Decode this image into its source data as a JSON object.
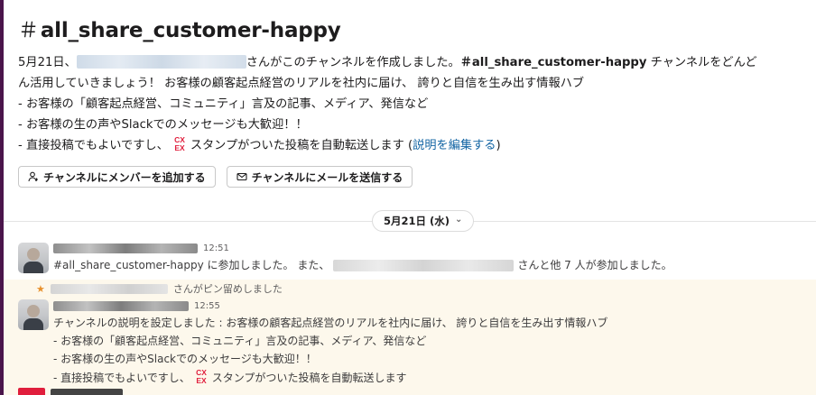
{
  "channel": {
    "hash": "＃",
    "name": "all_share_customer-happy"
  },
  "intro": {
    "date_prefix": "5月21日、",
    "created_text": "さんがこのチャンネルを作成しました。",
    "channel_ref": "＃all_share_customer-happy",
    "after_ref": " チャンネルをどんど",
    "line2": "ん活用していきましょう！ お客様の顧客起点経営のリアルを社内に届け、 誇りと自信を生み出す情報ハブ",
    "line3": "- お客様の「顧客起点経営、コミュニティ」言及の記事、メディア、発信など",
    "line4": "- お客様の生の声やSlackでのメッセージも大歓迎！！",
    "line5_before": "- 直接投稿でもよいですし、",
    "line5_after": "スタンプがついた投稿を自動転送します (",
    "edit_link": "説明を編集する",
    "line5_close": ")"
  },
  "actions": {
    "add_members": "チャンネルにメンバーを追加する",
    "send_email": "チャンネルにメールを送信する"
  },
  "date_divider": {
    "label": "5月21日 (水)",
    "chevron": "⌄"
  },
  "messages": [
    {
      "time": "12:51",
      "text_before": "#all_share_customer-happy に参加しました。 また、",
      "text_after": "さんと他 7 人が参加しました。"
    },
    {
      "pin_text": "さんがピン留めしました",
      "time": "12:55",
      "lines": [
        "チャンネルの説明を設定しました : お客様の顧客起点経営のリアルを社内に届け、 誇りと自信を生み出す情報ハブ",
        "- お客様の「顧客起点経営、コミュニティ」言及の記事、メディア、発信など",
        "- お客様の生の声やSlackでのメッセージも大歓迎！！"
      ],
      "last_before": "- 直接投稿でもよいですし、",
      "last_after": "スタンプがついた投稿を自動転送します"
    }
  ],
  "icons": {
    "stamp": "cx-stamp-icon",
    "add_member": "person-add-icon",
    "email": "envelope-icon",
    "pin": "pin-icon"
  },
  "colors": {
    "sidebar": "#4a154b",
    "link": "#1264a3",
    "pinned_bg": "#fdf8ec",
    "stamp_red": "#e01e3c"
  }
}
